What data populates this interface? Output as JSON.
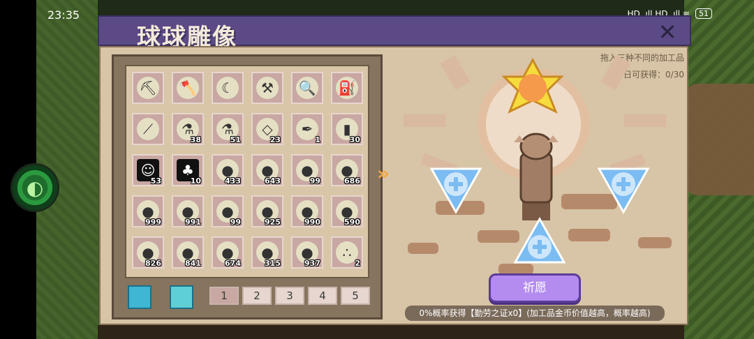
{
  "status_bar": {
    "time": "23:35",
    "icons": "HD .ıll HD .ıll ≋",
    "battery": "51"
  },
  "window": {
    "title": "球球雕像",
    "close_icon": "close-icon"
  },
  "inventory": {
    "slots": [
      {
        "icon": "pickaxe",
        "glyph": "⛏",
        "count": ""
      },
      {
        "icon": "axe",
        "glyph": "🪓",
        "count": ""
      },
      {
        "icon": "sickle",
        "glyph": "☾",
        "count": ""
      },
      {
        "icon": "hoe",
        "glyph": "⚒",
        "count": ""
      },
      {
        "icon": "shovel",
        "glyph": "🔍",
        "count": ""
      },
      {
        "icon": "watering-can",
        "glyph": "⛽",
        "count": ""
      },
      {
        "icon": "fishing-rod",
        "glyph": "⟋",
        "count": ""
      },
      {
        "icon": "potion-flask",
        "glyph": "⚗",
        "count": "38"
      },
      {
        "icon": "potion-flask",
        "glyph": "⚗",
        "count": "51"
      },
      {
        "icon": "crystal",
        "glyph": "◇",
        "count": "23"
      },
      {
        "icon": "feather",
        "glyph": "✒",
        "count": "1"
      },
      {
        "icon": "bottle",
        "glyph": "▮",
        "count": "30"
      },
      {
        "icon": "portrait-card",
        "glyph": "☺",
        "count": "53",
        "square": true
      },
      {
        "icon": "mushroom-card",
        "glyph": "♣",
        "count": "10",
        "square": true
      },
      {
        "icon": "seed-bag",
        "glyph": "●",
        "count": "433"
      },
      {
        "icon": "seed-bag",
        "glyph": "●",
        "count": "643"
      },
      {
        "icon": "seed-bag",
        "glyph": "●",
        "count": "99"
      },
      {
        "icon": "seed-bag",
        "glyph": "●",
        "count": "686"
      },
      {
        "icon": "seed-bag",
        "glyph": "●",
        "count": "999"
      },
      {
        "icon": "seed-bag",
        "glyph": "●",
        "count": "991"
      },
      {
        "icon": "seed-bag",
        "glyph": "●",
        "count": "99"
      },
      {
        "icon": "seed-bag",
        "glyph": "●",
        "count": "925"
      },
      {
        "icon": "seed-bag",
        "glyph": "●",
        "count": "990"
      },
      {
        "icon": "seed-bag",
        "glyph": "●",
        "count": "590"
      },
      {
        "icon": "seed-bag",
        "glyph": "●",
        "count": "826"
      },
      {
        "icon": "seed-bag",
        "glyph": "●",
        "count": "841"
      },
      {
        "icon": "seed-bag",
        "glyph": "●",
        "count": "674"
      },
      {
        "icon": "seed-bag",
        "glyph": "●",
        "count": "315"
      },
      {
        "icon": "seed-bag",
        "glyph": "●",
        "count": "937"
      },
      {
        "icon": "seeds",
        "glyph": "∴",
        "count": "2"
      }
    ],
    "pages": [
      "1",
      "2",
      "3",
      "4",
      "5"
    ],
    "active_page": "1"
  },
  "statue": {
    "hint": "拖入三种不同的加工品",
    "today_label": "今日可获得：0/30",
    "pray_label": "祈愿",
    "probability_text": "0%概率获得【勤劳之证x0】(加工品金币价值越高，概率越高)"
  },
  "colors": {
    "title_bar": "#5b4a86",
    "panel": "#d8c4a6",
    "pray_button": "#b48cf0",
    "slot": "#c9a7a2"
  }
}
